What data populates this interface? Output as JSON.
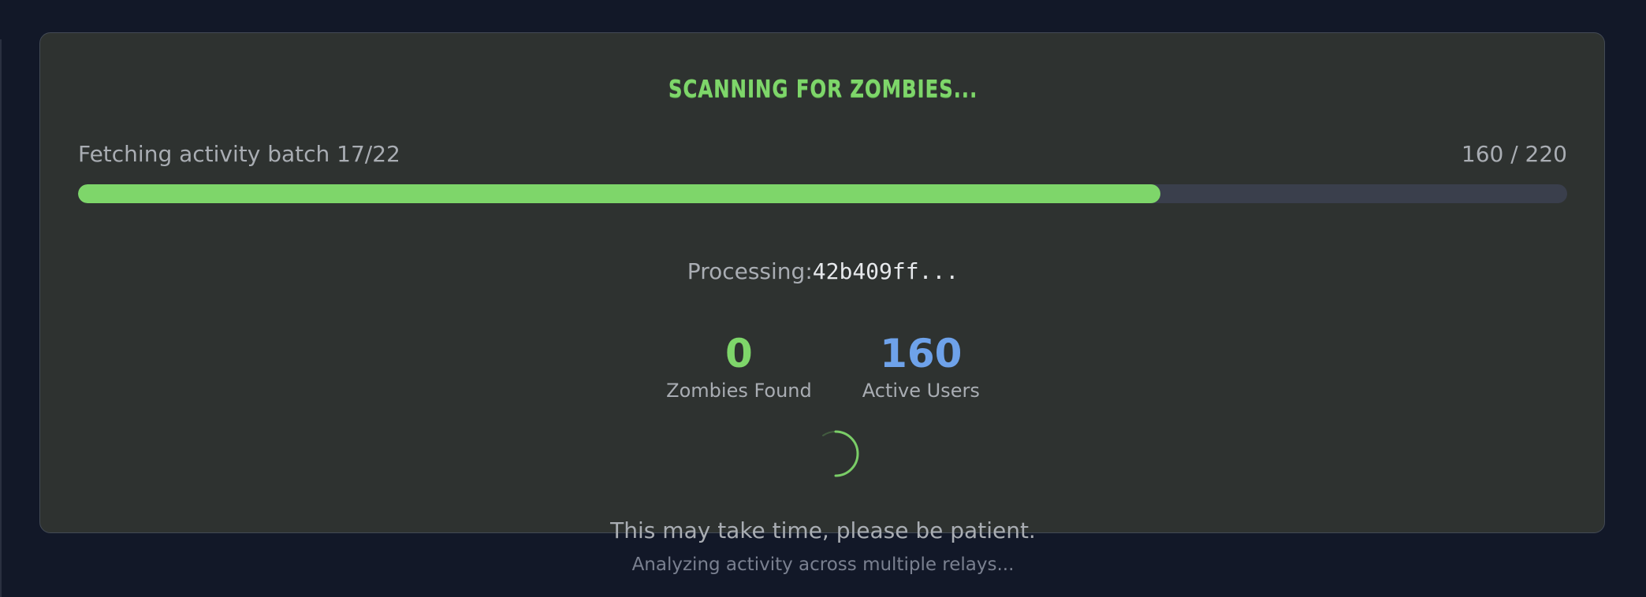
{
  "scan": {
    "title": "SCANNING FOR ZOMBIES...",
    "status": "Fetching activity batch 17/22",
    "progress_count": "160 / 220",
    "progress_fraction": 0.727,
    "processing_label": "Processing:",
    "processing_id": "42b409ff..."
  },
  "stats": {
    "zombies": {
      "value": "0",
      "label": "Zombies Found"
    },
    "active": {
      "value": "160",
      "label": "Active Users"
    }
  },
  "footer": {
    "patience": "This may take time, please be patient.",
    "analyzing": "Analyzing activity across multiple relays..."
  },
  "colors": {
    "accent_green": "#7ed66a",
    "accent_blue": "#6ea2ea",
    "background": "#121828",
    "panel": "#2e3230"
  },
  "icons": {
    "spinner": "loading-spinner-icon"
  }
}
